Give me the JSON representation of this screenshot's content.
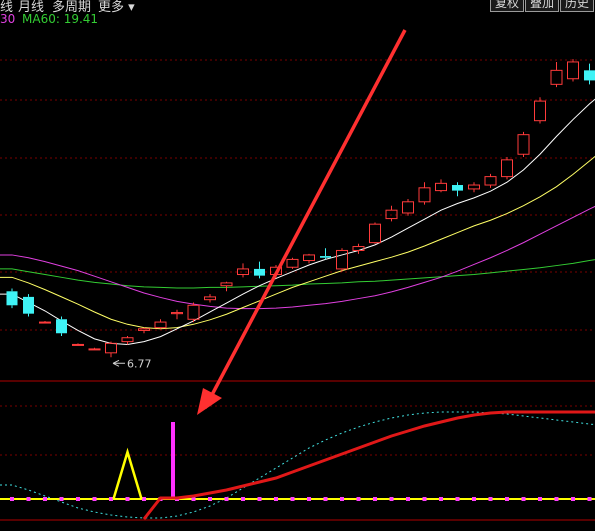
{
  "toolbar": {
    "items": [
      "线",
      "月线",
      "多周期",
      "更多 ▾"
    ],
    "buttons": [
      "复权",
      "叠加",
      "历史"
    ]
  },
  "legend": {
    "ma30_label": "30",
    "ma60_label": "MA60: 19.41"
  },
  "colors": {
    "background": "#000000",
    "up_candle": "#ff3b3b",
    "down_candle": "#3ff3f6",
    "ma_short": "#ffffff",
    "ma_mid": "#ffff66",
    "ma30": "#e040e0",
    "ma60": "#33cc33",
    "arrow": "#ff3030",
    "indicator_curve": "#e01818",
    "signal_line": "#ffff00",
    "signal_dots": "#ff40ff",
    "triangle": "#ffff00",
    "signal_spike": "#ff30ff",
    "dashed_curve": "#40e0e0",
    "grid": "#7a0000"
  },
  "chart_data": [
    {
      "type": "candlestick",
      "title": "",
      "low_annotation": "6.77",
      "candles": [
        {
          "o": 7.95,
          "h": 8.0,
          "l": 7.65,
          "c": 7.7
        },
        {
          "o": 7.85,
          "h": 7.9,
          "l": 7.5,
          "c": 7.55
        },
        {
          "o": 7.4,
          "h": 7.42,
          "l": 7.38,
          "c": 7.4
        },
        {
          "o": 7.45,
          "h": 7.5,
          "l": 7.15,
          "c": 7.2
        },
        {
          "o": 7.0,
          "h": 7.02,
          "l": 6.98,
          "c": 7.0
        },
        {
          "o": 6.92,
          "h": 6.94,
          "l": 6.9,
          "c": 6.92
        },
        {
          "o": 6.85,
          "h": 7.05,
          "l": 6.77,
          "c": 7.02
        },
        {
          "o": 7.05,
          "h": 7.15,
          "l": 7.0,
          "c": 7.12
        },
        {
          "o": 7.25,
          "h": 7.3,
          "l": 7.2,
          "c": 7.28
        },
        {
          "o": 7.3,
          "h": 7.45,
          "l": 7.28,
          "c": 7.4
        },
        {
          "o": 7.55,
          "h": 7.62,
          "l": 7.45,
          "c": 7.57
        },
        {
          "o": 7.45,
          "h": 7.75,
          "l": 7.4,
          "c": 7.7
        },
        {
          "o": 7.8,
          "h": 7.9,
          "l": 7.75,
          "c": 7.85
        },
        {
          "o": 8.05,
          "h": 8.12,
          "l": 7.95,
          "c": 8.1
        },
        {
          "o": 8.25,
          "h": 8.45,
          "l": 8.2,
          "c": 8.35
        },
        {
          "o": 8.35,
          "h": 8.48,
          "l": 8.18,
          "c": 8.23
        },
        {
          "o": 8.25,
          "h": 8.42,
          "l": 8.2,
          "c": 8.38
        },
        {
          "o": 8.38,
          "h": 8.55,
          "l": 8.35,
          "c": 8.52
        },
        {
          "o": 8.5,
          "h": 8.62,
          "l": 8.45,
          "c": 8.6
        },
        {
          "o": 8.58,
          "h": 8.72,
          "l": 8.52,
          "c": 8.55
        },
        {
          "o": 8.35,
          "h": 8.72,
          "l": 8.3,
          "c": 8.68
        },
        {
          "o": 8.68,
          "h": 8.8,
          "l": 8.62,
          "c": 8.75
        },
        {
          "o": 8.82,
          "h": 9.18,
          "l": 8.8,
          "c": 9.15
        },
        {
          "o": 9.25,
          "h": 9.48,
          "l": 9.2,
          "c": 9.4
        },
        {
          "o": 9.35,
          "h": 9.6,
          "l": 9.3,
          "c": 9.55
        },
        {
          "o": 9.55,
          "h": 9.9,
          "l": 9.5,
          "c": 9.8
        },
        {
          "o": 9.75,
          "h": 9.95,
          "l": 9.72,
          "c": 9.88
        },
        {
          "o": 9.85,
          "h": 9.9,
          "l": 9.65,
          "c": 9.75
        },
        {
          "o": 9.78,
          "h": 9.9,
          "l": 9.72,
          "c": 9.85
        },
        {
          "o": 9.85,
          "h": 10.05,
          "l": 9.8,
          "c": 10.0
        },
        {
          "o": 10.0,
          "h": 10.35,
          "l": 9.95,
          "c": 10.3
        },
        {
          "o": 10.4,
          "h": 10.8,
          "l": 10.35,
          "c": 10.75
        },
        {
          "o": 11.0,
          "h": 11.42,
          "l": 10.95,
          "c": 11.35
        },
        {
          "o": 11.65,
          "h": 12.05,
          "l": 11.6,
          "c": 11.9
        },
        {
          "o": 11.75,
          "h": 12.1,
          "l": 11.7,
          "c": 12.05
        },
        {
          "o": 11.9,
          "h": 12.02,
          "l": 11.65,
          "c": 11.72
        }
      ],
      "ma_short": [
        7.9,
        7.75,
        7.6,
        7.42,
        7.25,
        7.1,
        7.02,
        7.0,
        7.05,
        7.14,
        7.28,
        7.42,
        7.58,
        7.74,
        7.9,
        8.05,
        8.18,
        8.3,
        8.42,
        8.52,
        8.6,
        8.68,
        8.78,
        8.92,
        9.08,
        9.24,
        9.4,
        9.52,
        9.62,
        9.74,
        9.9,
        10.12,
        10.4,
        10.72,
        11.02,
        11.3,
        11.55
      ],
      "ma_mid": [
        8.2,
        8.1,
        7.98,
        7.85,
        7.72,
        7.58,
        7.45,
        7.36,
        7.3,
        7.28,
        7.3,
        7.36,
        7.44,
        7.54,
        7.66,
        7.78,
        7.9,
        8.02,
        8.12,
        8.22,
        8.32,
        8.4,
        8.48,
        8.56,
        8.65,
        8.76,
        8.88,
        9.0,
        9.12,
        9.22,
        9.34,
        9.48,
        9.64,
        9.82,
        10.04,
        10.28,
        10.52
      ],
      "ma30": [
        8.6,
        8.55,
        8.48,
        8.4,
        8.32,
        8.22,
        8.12,
        8.02,
        7.92,
        7.84,
        7.77,
        7.72,
        7.68,
        7.65,
        7.64,
        7.64,
        7.65,
        7.67,
        7.7,
        7.73,
        7.77,
        7.82,
        7.87,
        7.94,
        8.02,
        8.11,
        8.2,
        8.31,
        8.43,
        8.55,
        8.68,
        8.82,
        8.97,
        9.12,
        9.27,
        9.42,
        9.56
      ],
      "ma60": [
        8.35,
        8.3,
        8.25,
        8.2,
        8.15,
        8.11,
        8.08,
        8.05,
        8.03,
        8.02,
        8.01,
        8.01,
        8.02,
        8.02,
        8.03,
        8.04,
        8.05,
        8.06,
        8.08,
        8.09,
        8.1,
        8.12,
        8.13,
        8.15,
        8.17,
        8.19,
        8.21,
        8.23,
        8.25,
        8.28,
        8.31,
        8.34,
        8.37,
        8.41,
        8.45,
        8.5,
        8.55
      ],
      "ylim": [
        6.4,
        12.8
      ]
    },
    {
      "type": "line",
      "title": "",
      "signal_x": [
        6,
        10
      ],
      "triangle_x": 7,
      "spike_x": 10,
      "curve": [
        0.0,
        0.0,
        0.0,
        0.0,
        0.0,
        0.0,
        0.0,
        0.0,
        0.0,
        0.0,
        0.0,
        0.02,
        0.05,
        0.08,
        0.12,
        0.16,
        0.2,
        0.26,
        0.32,
        0.38,
        0.44,
        0.5,
        0.56,
        0.62,
        0.67,
        0.72,
        0.76,
        0.8,
        0.83,
        0.85,
        0.86,
        0.86,
        0.86,
        0.86,
        0.86,
        0.86,
        0.86
      ],
      "dashed": [
        0.15,
        0.1,
        0.04,
        -0.02,
        -0.08,
        -0.12,
        -0.15,
        -0.17,
        -0.18,
        -0.18,
        -0.16,
        -0.12,
        -0.06,
        0.02,
        0.12,
        0.22,
        0.32,
        0.42,
        0.52,
        0.6,
        0.67,
        0.73,
        0.78,
        0.82,
        0.85,
        0.87,
        0.88,
        0.88,
        0.88,
        0.87,
        0.86,
        0.84,
        0.82,
        0.8,
        0.78,
        0.76,
        0.74
      ],
      "ylim": [
        -0.2,
        1.0
      ]
    }
  ]
}
